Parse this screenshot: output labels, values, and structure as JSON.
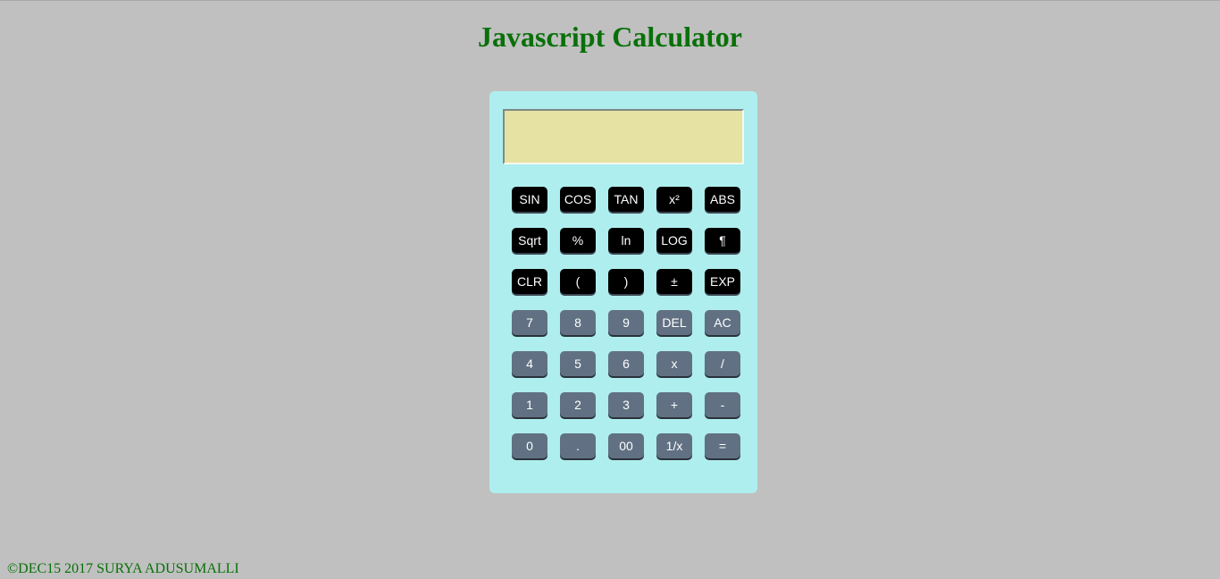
{
  "header": {
    "title": "Javascript Calculator"
  },
  "display": {
    "value": ""
  },
  "keypad": {
    "row1": [
      "SIN",
      "COS",
      "TAN",
      "x²",
      "ABS"
    ],
    "row2": [
      "Sqrt",
      "%",
      "ln",
      "LOG",
      "¶"
    ],
    "row3": [
      "CLR",
      "(",
      ")",
      "±",
      "EXP"
    ],
    "row4": [
      "7",
      "8",
      "9",
      "DEL",
      "AC"
    ],
    "row5": [
      "4",
      "5",
      "6",
      "x",
      "/"
    ],
    "row6": [
      "1",
      "2",
      "3",
      "+",
      "-"
    ],
    "row7": [
      "0",
      ".",
      "00",
      "1/x",
      "="
    ]
  },
  "footer": {
    "copyright": "©DEC15 2017 SURYA ADUSUMALLI"
  },
  "colors": {
    "background": "#c0c0c0",
    "calculator_body": "#afeeee",
    "display": "#e6e2a4",
    "function_key": "#000000",
    "number_key": "#617183",
    "title_text": "#087008"
  }
}
